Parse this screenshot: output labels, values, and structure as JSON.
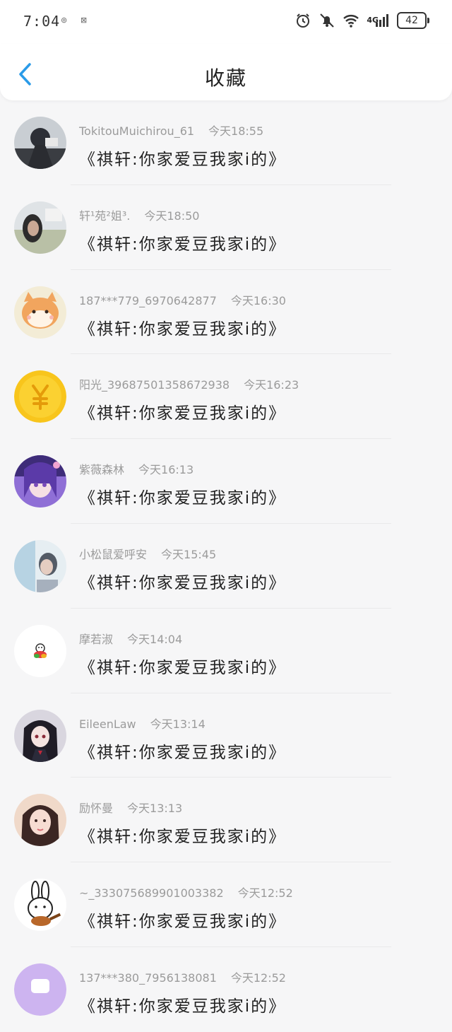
{
  "status": {
    "time": "7:04",
    "indicators": [
      "⊚",
      "⊠"
    ],
    "network": "4G",
    "battery": "42"
  },
  "header": {
    "title": "收藏",
    "back_icon": "chevron-left-icon"
  },
  "colors": {
    "accent": "#2a9be8",
    "background": "#f6f6f7"
  },
  "items": [
    {
      "name": "TokitouMuichirou_61",
      "time": "今天18:55",
      "content": "《祺轩:你家爱豆我家i的》",
      "avatar": "anime-warrior"
    },
    {
      "name": "轩¹苑²姐³.",
      "time": "今天18:50",
      "content": "《祺轩:你家爱豆我家i的》",
      "avatar": "person-photo"
    },
    {
      "name": "187***779_6970642877",
      "time": "今天16:30",
      "content": "《祺轩:你家爱豆我家i的》",
      "avatar": "shiba-dog"
    },
    {
      "name": "阳光_39687501358672938",
      "time": "今天16:23",
      "content": "《祺轩:你家爱豆我家i的》",
      "avatar": "yen-coin"
    },
    {
      "name": "紫薇森林",
      "time": "今天16:13",
      "content": "《祺轩:你家爱豆我家i的》",
      "avatar": "purple-anime"
    },
    {
      "name": "小松鼠爱呼安",
      "time": "今天15:45",
      "content": "《祺轩:你家爱豆我家i的》",
      "avatar": "profile-photo"
    },
    {
      "name": "摩若淑",
      "time": "今天14:04",
      "content": "《祺轩:你家爱豆我家i的》",
      "avatar": "small-cartoon"
    },
    {
      "name": "EileenLaw",
      "time": "今天13:14",
      "content": "《祺轩:你家爱豆我家i的》",
      "avatar": "dark-anime"
    },
    {
      "name": "励怀曼",
      "time": "今天13:13",
      "content": "《祺轩:你家爱豆我家i的》",
      "avatar": "girl-photo"
    },
    {
      "name": "~_333075689901003382",
      "time": "今天12:52",
      "content": "《祺轩:你家爱豆我家i的》",
      "avatar": "rabbit-guitar"
    },
    {
      "name": "137***380_7956138081",
      "time": "今天12:52",
      "content": "《祺轩:你家爱豆我家i的》",
      "avatar": "purple-icon"
    }
  ]
}
